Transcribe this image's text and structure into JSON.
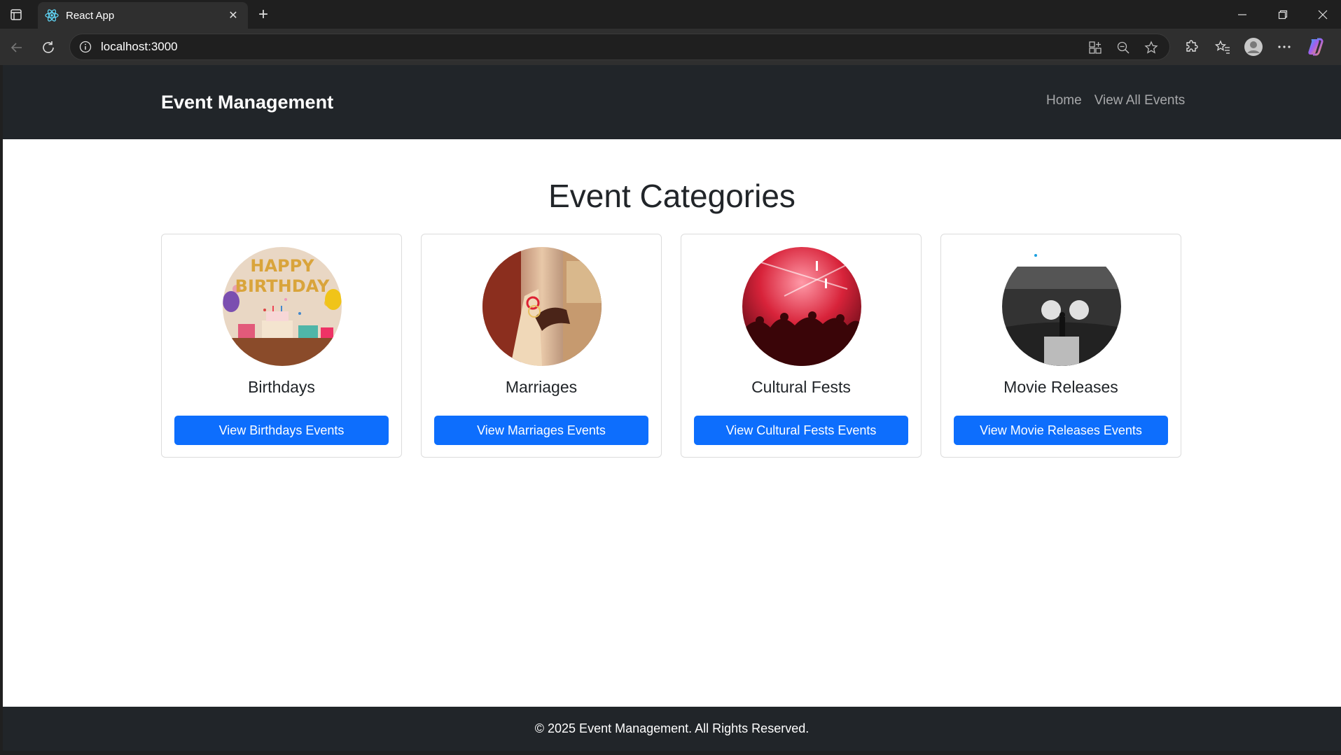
{
  "browser": {
    "tab_title": "React App",
    "url": "localhost:3000"
  },
  "navbar": {
    "brand": "Event Management",
    "links": [
      "Home",
      "View All Events"
    ]
  },
  "page": {
    "heading": "Event Categories"
  },
  "categories": [
    {
      "title": "Birthdays",
      "button": "View Birthdays Events",
      "image_icon": "birthday-photo"
    },
    {
      "title": "Marriages",
      "button": "View Marriages Events",
      "image_icon": "wedding-photo"
    },
    {
      "title": "Cultural Fests",
      "button": "View Cultural Fests Events",
      "image_icon": "concert-photo"
    },
    {
      "title": "Movie Releases",
      "button": "View Movie Releases Events",
      "image_icon": "stage-photo"
    }
  ],
  "footer": {
    "text": "© 2025 Event Management. All Rights Reserved."
  },
  "colors": {
    "navbar_bg": "#212529",
    "primary_button": "#0d6efd",
    "page_bg": "#ffffff"
  }
}
